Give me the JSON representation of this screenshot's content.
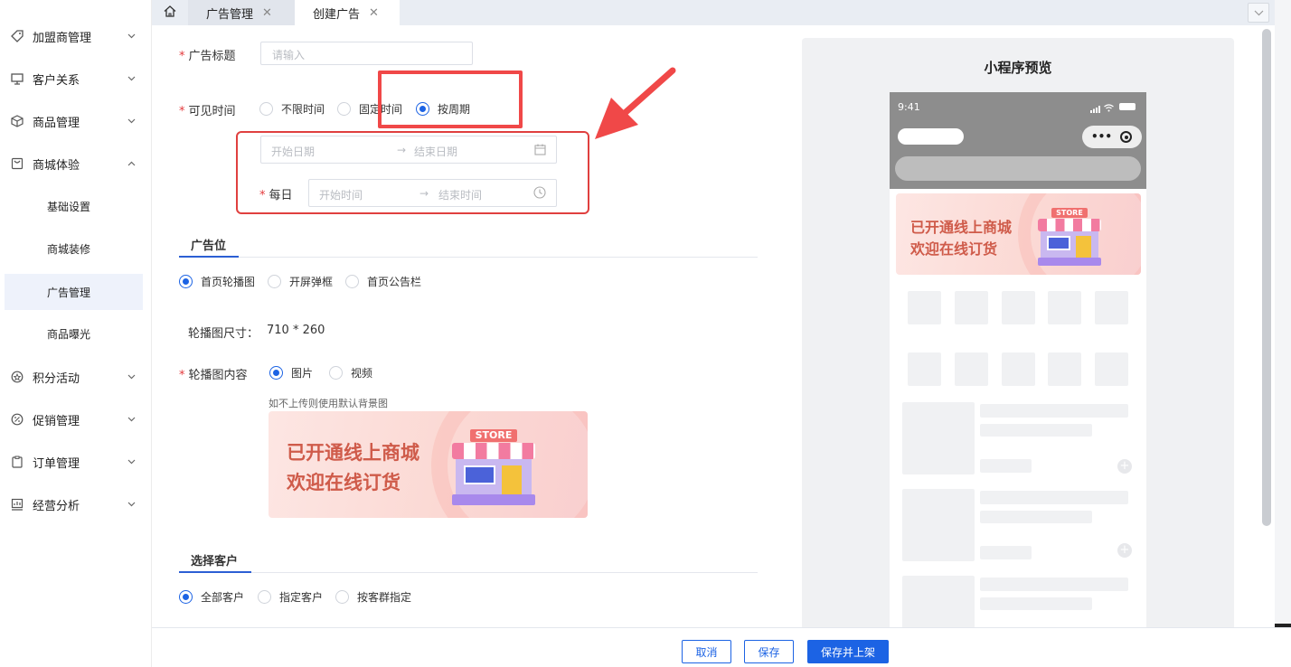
{
  "sidebar": {
    "items": [
      {
        "label": "加盟商管理",
        "icon": "tag-icon"
      },
      {
        "label": "客户关系",
        "icon": "monitor-icon"
      },
      {
        "label": "商品管理",
        "icon": "box-icon"
      },
      {
        "label": "商城体验",
        "icon": "shop-icon",
        "expanded": true
      },
      {
        "label": "积分活动",
        "icon": "points-icon"
      },
      {
        "label": "促销管理",
        "icon": "percent-icon"
      },
      {
        "label": "订单管理",
        "icon": "clipboard-icon"
      },
      {
        "label": "经营分析",
        "icon": "chart-icon"
      }
    ],
    "sub_items": [
      "基础设置",
      "商城装修",
      "广告管理",
      "商品曝光"
    ],
    "active_sub": "广告管理"
  },
  "tabs": [
    {
      "label": "广告管理"
    },
    {
      "label": "创建广告",
      "active": true
    }
  ],
  "form": {
    "title_label": "广告标题",
    "title_placeholder": "请输入",
    "visible_time_label": "可见时间",
    "visible_options": [
      "不限时间",
      "固定时间",
      "按周期"
    ],
    "visible_selected": "按周期",
    "start_date_ph": "开始日期",
    "end_date_ph": "结束日期",
    "daily_label": "每日",
    "start_time_ph": "开始时间",
    "end_time_ph": "结束时间",
    "ad_slot_title": "广告位",
    "slot_options": [
      "首页轮播图",
      "开屏弹框",
      "首页公告栏"
    ],
    "slot_selected": "首页轮播图",
    "size_label": "轮播图尺寸：",
    "size_value": "710 * 260",
    "content_label": "轮播图内容",
    "content_options": [
      "图片",
      "视频"
    ],
    "content_selected": "图片",
    "bg_hint": "如不上传则使用默认背景图",
    "customer_title": "选择客户",
    "customer_options": [
      "全部客户",
      "指定客户",
      "按客群指定"
    ],
    "customer_selected": "全部客户"
  },
  "banner": {
    "line1": "已开通线上商城",
    "line2": "欢迎在线订货",
    "store_sign": "STORE"
  },
  "preview": {
    "title": "小程序预览",
    "time": "9:41"
  },
  "footer": {
    "cancel": "取消",
    "save": "保存",
    "save_publish": "保存并上架"
  },
  "annotation": {
    "color": "#f04848"
  },
  "colors": {
    "primary": "#1c63e4",
    "required": "#e3393c"
  }
}
